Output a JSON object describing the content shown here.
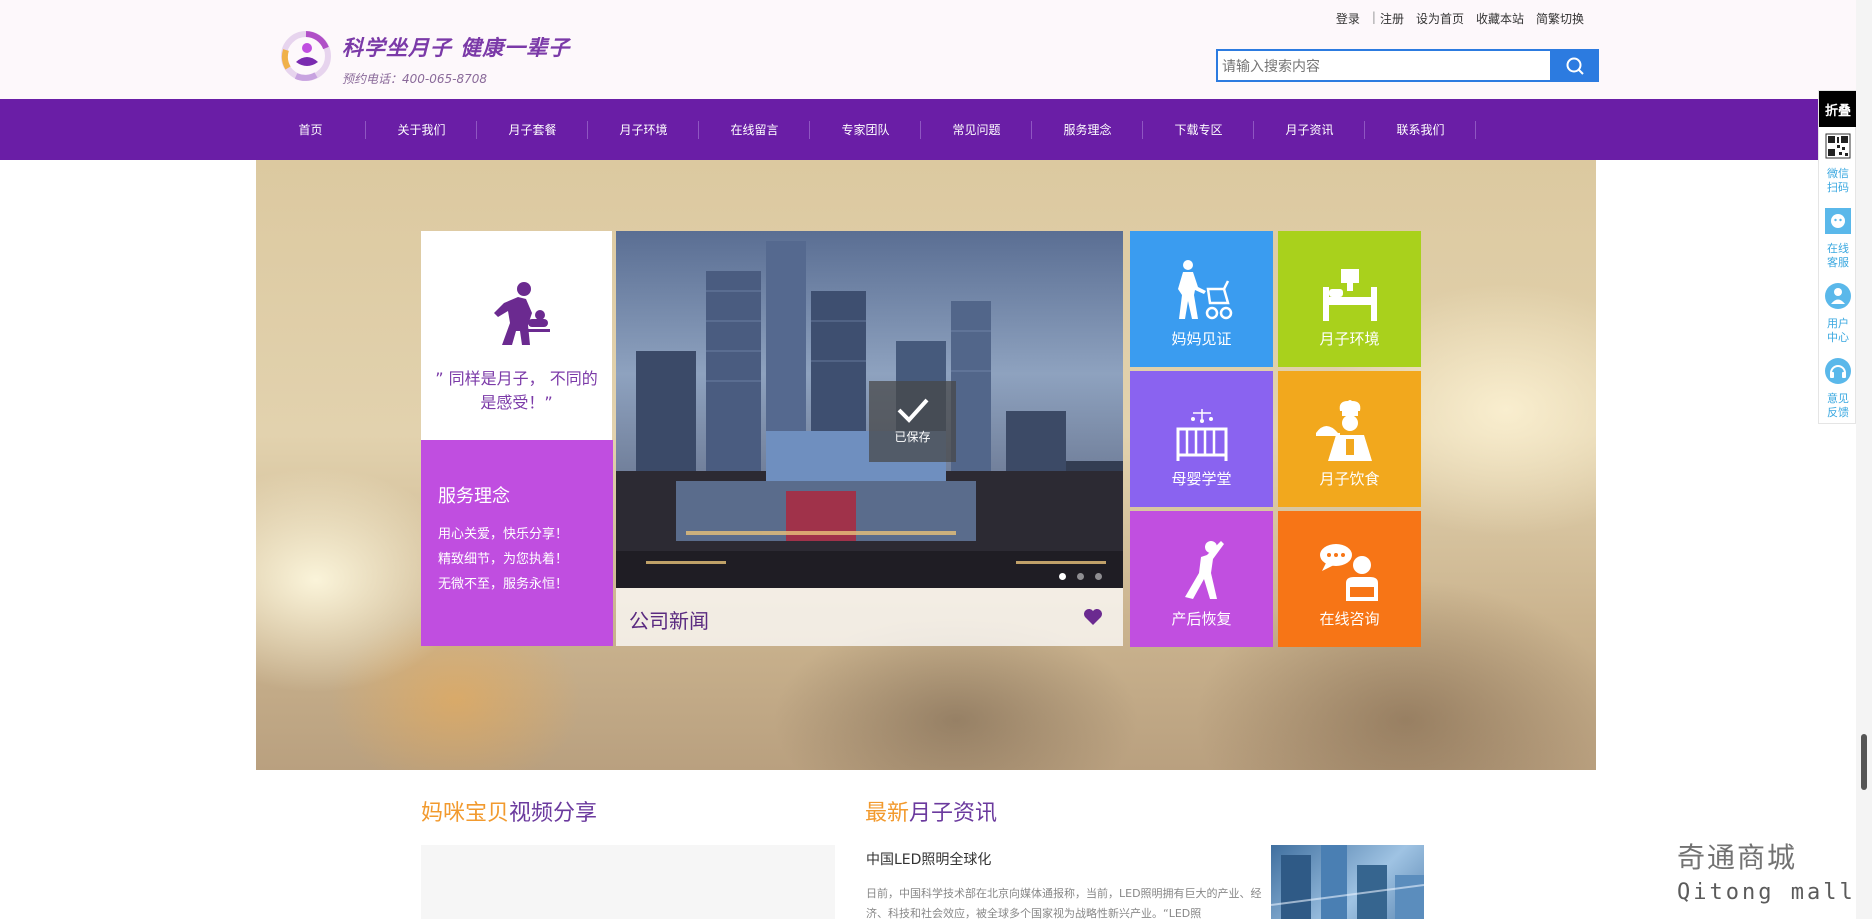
{
  "header": {
    "slogan": "科学坐月子  健康一辈子",
    "hotline": "预约电话：400-065-8708",
    "toplinks": [
      "登录",
      "注册",
      "设为首页",
      "收藏本站",
      "简繁切换"
    ],
    "search_placeholder": "请输入搜索内容"
  },
  "nav": {
    "items": [
      "首页",
      "关于我们",
      "月子套餐",
      "月子环境",
      "在线留言",
      "专家团队",
      "常见问题",
      "服务理念",
      "下载专区",
      "月子资讯",
      "联系我们"
    ]
  },
  "banner": {
    "quote": "” 同样是月子， 不同的是感受！”",
    "service": {
      "title": "服务理念",
      "lines": [
        "用心关爱，快乐分享！",
        "精致细节，为您执着！",
        "无微不至，服务永恒！"
      ]
    },
    "saved_label": "已保存",
    "news_title": "公司新闻",
    "tiles": [
      {
        "label": "妈妈见证",
        "color": "#3a9cf0",
        "icon": "mother-stroller-icon"
      },
      {
        "label": "月子环境",
        "color": "#a9d11c",
        "icon": "bed-icon"
      },
      {
        "label": "母婴学堂",
        "color": "#8a63f0",
        "icon": "crib-icon"
      },
      {
        "label": "月子饮食",
        "color": "#f2a81d",
        "icon": "chef-icon"
      },
      {
        "label": "产后恢复",
        "color": "#c14fe0",
        "icon": "yoga-icon"
      },
      {
        "label": "在线咨询",
        "color": "#f77516",
        "icon": "consult-icon"
      }
    ]
  },
  "video_section": {
    "accent": "妈咪宝贝",
    "rest": "视频分享"
  },
  "news_section": {
    "accent": "最新",
    "rest": "月子资讯",
    "item_title": "中国LED照明全球化",
    "item_desc": "日前，中国科学技术部在北京向媒体通报称，当前，LED照明拥有巨大的产业、经济、科技和社会效应，被全球多个国家视为战略性新兴产业。“LED照"
  },
  "float_bar": {
    "fold_label": "折叠",
    "items": [
      "微信扫码",
      "在线客服",
      "用户中心",
      "意见反馈"
    ]
  },
  "watermark": {
    "cn": "奇通商城",
    "en": "Qitong mall"
  }
}
